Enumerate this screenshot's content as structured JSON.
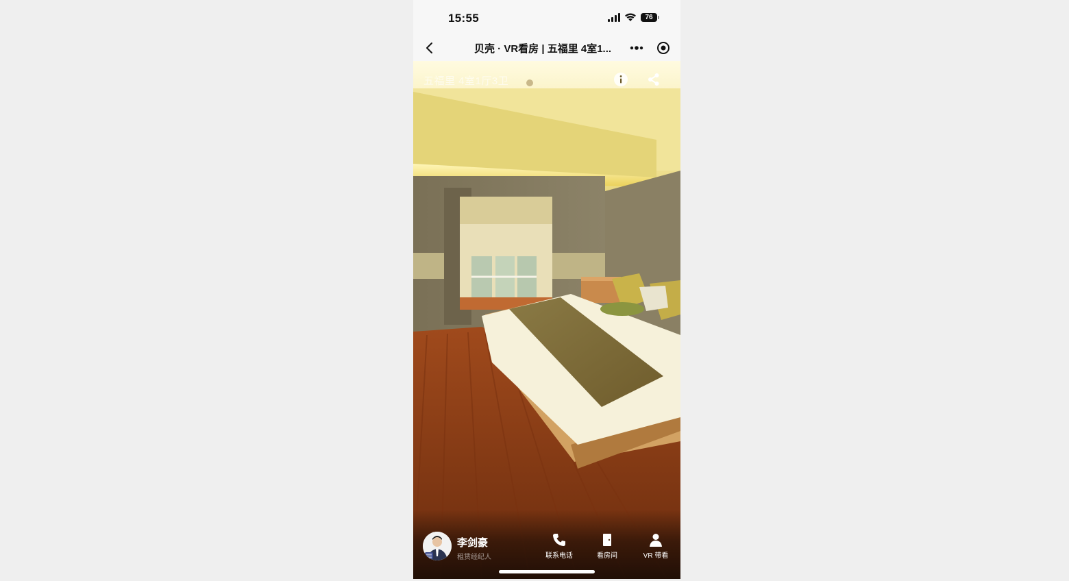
{
  "status_bar": {
    "time": "15:55",
    "battery": "76"
  },
  "nav": {
    "title": "贝壳 · VR看房 | 五福里 4室1...",
    "back_icon": "chevron-left-icon",
    "more_icon": "more-dots-icon",
    "mini_program_icon": "target-icon"
  },
  "viewer": {
    "listing_title": "五福里 4室1厅3卫",
    "info_icon": "info-icon",
    "share_icon": "share-icon"
  },
  "agent": {
    "name": "李剑豪",
    "role": "租赁经纪人"
  },
  "actions": [
    {
      "label": "联系电话",
      "icon": "phone-icon"
    },
    {
      "label": "看房间",
      "icon": "door-icon"
    },
    {
      "label": "VR 带看",
      "icon": "person-icon"
    }
  ]
}
